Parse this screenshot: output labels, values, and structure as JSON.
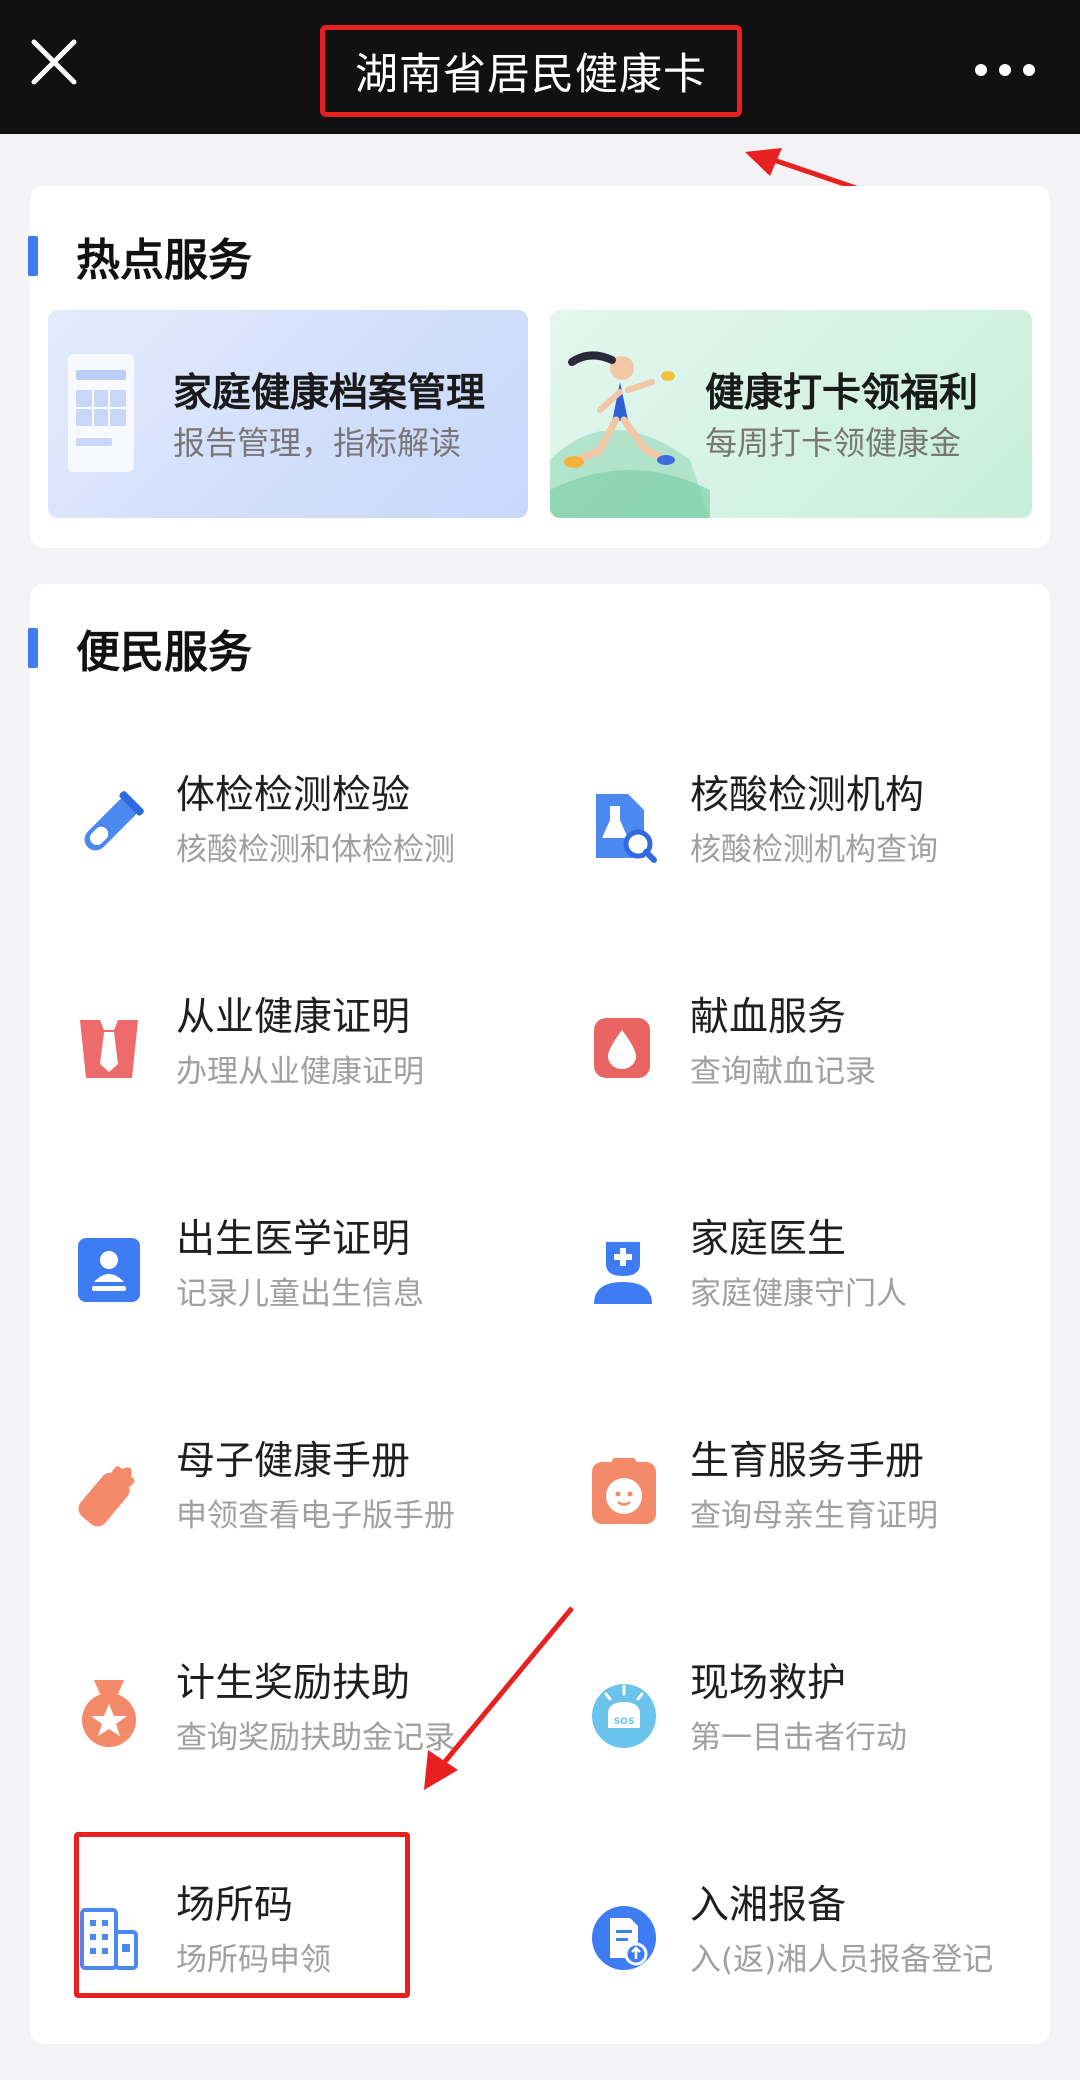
{
  "topbar": {
    "title": "湖南省居民健康卡"
  },
  "hot_services": {
    "heading": "热点服务",
    "banners": [
      {
        "title": "家庭健康档案管理",
        "subtitle": "报告管理，指标解读"
      },
      {
        "title": "健康打卡领福利",
        "subtitle": "每周打卡领健康金"
      }
    ]
  },
  "convenience_services": {
    "heading": "便民服务",
    "items": [
      {
        "title": "体检检测检验",
        "subtitle": "核酸检测和体检检测",
        "icon": "test-tube-icon"
      },
      {
        "title": "核酸检测机构",
        "subtitle": "核酸检测机构查询",
        "icon": "lab-search-icon"
      },
      {
        "title": "从业健康证明",
        "subtitle": "办理从业健康证明",
        "icon": "tie-icon"
      },
      {
        "title": "献血服务",
        "subtitle": "查询献血记录",
        "icon": "blood-drop-icon"
      },
      {
        "title": "出生医学证明",
        "subtitle": "记录儿童出生信息",
        "icon": "person-card-icon"
      },
      {
        "title": "家庭医生",
        "subtitle": "家庭健康守门人",
        "icon": "doctor-icon"
      },
      {
        "title": "母子健康手册",
        "subtitle": "申领查看电子版手册",
        "icon": "baby-bottle-icon"
      },
      {
        "title": "生育服务手册",
        "subtitle": "查询母亲生育证明",
        "icon": "baby-face-icon"
      },
      {
        "title": "计生奖励扶助",
        "subtitle": "查询奖励扶助金记录",
        "icon": "medal-icon"
      },
      {
        "title": "现场救护",
        "subtitle": "第一目击者行动",
        "icon": "sos-icon"
      },
      {
        "title": "场所码",
        "subtitle": "场所码申领",
        "icon": "building-icon"
      },
      {
        "title": "入湘报备",
        "subtitle": "入(返)湘人员报备登记",
        "icon": "report-doc-icon"
      }
    ]
  },
  "colors": {
    "topbar_bg": "#111111",
    "accent_blue": "#3d7cf2",
    "annotation_red": "#e8201f"
  }
}
